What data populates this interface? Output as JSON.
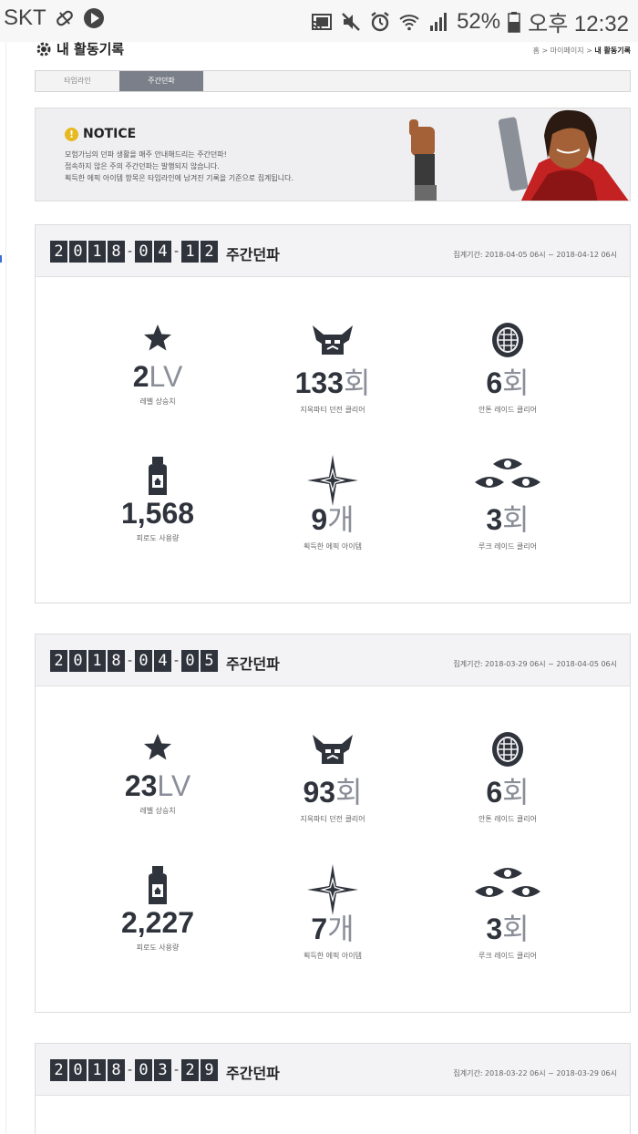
{
  "status_bar": {
    "carrier": "SKT",
    "battery": "52%",
    "time": "오후 12:32"
  },
  "page": {
    "title": "내 활동기록",
    "breadcrumb": {
      "home": "홈",
      "mypage": "마이페이지",
      "current": "내 활동기록"
    }
  },
  "tabs": [
    {
      "label": "타임라인",
      "active": false
    },
    {
      "label": "주간던파",
      "active": true
    }
  ],
  "notice": {
    "title": "NOTICE",
    "lines": [
      "모험가님의 던파 생활을 매주 안내해드리는 주간던파!",
      "접속하지 않은 주의 주간던파는 발행되지 않습니다.",
      "획득한 에픽 아이템 항목은 타임라인에 남겨진 기록을 기준으로 집계됩니다."
    ]
  },
  "weeks": [
    {
      "date_digits": [
        "2",
        "0",
        "1",
        "8",
        "-",
        "0",
        "4",
        "-",
        "1",
        "2"
      ],
      "label": "주간던파",
      "period": "집계기간: 2018-04-05 06시 ~ 2018-04-12 06시",
      "stats": [
        {
          "icon": "star-icon",
          "value": "2",
          "unit": "LV",
          "label": "레벨 상승치"
        },
        {
          "icon": "demon-helmet-icon",
          "value": "133",
          "unit": "회",
          "label": "지옥파티 던전 클리어"
        },
        {
          "icon": "anton-shell-icon",
          "value": "6",
          "unit": "회",
          "label": "안톤 레이드 클리어"
        },
        {
          "icon": "potion-bottle-icon",
          "value": "1,568",
          "unit": "",
          "label": "피로도 사용량"
        },
        {
          "icon": "epic-sparkle-icon",
          "value": "9",
          "unit": "개",
          "label": "획득한 에픽 아이템"
        },
        {
          "icon": "luke-eyes-icon",
          "value": "3",
          "unit": "회",
          "label": "루크 레이드 클리어"
        }
      ]
    },
    {
      "date_digits": [
        "2",
        "0",
        "1",
        "8",
        "-",
        "0",
        "4",
        "-",
        "0",
        "5"
      ],
      "label": "주간던파",
      "period": "집계기간: 2018-03-29 06시 ~ 2018-04-05 06시",
      "stats": [
        {
          "icon": "star-icon",
          "value": "23",
          "unit": "LV",
          "label": "레벨 상승치"
        },
        {
          "icon": "demon-helmet-icon",
          "value": "93",
          "unit": "회",
          "label": "지옥파티 던전 클리어"
        },
        {
          "icon": "anton-shell-icon",
          "value": "6",
          "unit": "회",
          "label": "안톤 레이드 클리어"
        },
        {
          "icon": "potion-bottle-icon",
          "value": "2,227",
          "unit": "",
          "label": "피로도 사용량"
        },
        {
          "icon": "epic-sparkle-icon",
          "value": "7",
          "unit": "개",
          "label": "획득한 에픽 아이템"
        },
        {
          "icon": "luke-eyes-icon",
          "value": "3",
          "unit": "회",
          "label": "루크 레이드 클리어"
        }
      ]
    },
    {
      "date_digits": [
        "2",
        "0",
        "1",
        "8",
        "-",
        "0",
        "3",
        "-",
        "2",
        "9"
      ],
      "label": "주간던파",
      "period": "집계기간: 2018-03-22 06시 ~ 2018-03-29 06시",
      "stats": []
    }
  ]
}
